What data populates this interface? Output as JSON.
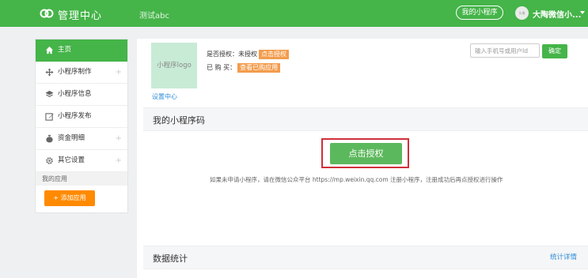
{
  "header": {
    "brand": "管理中心",
    "account": "测试abc",
    "mini_program_button": "我的小程序",
    "avatar_text": "头像",
    "username": "大陶微信小..."
  },
  "sidebar": {
    "items": [
      {
        "label": "主页",
        "icon": "home-icon",
        "active": true
      },
      {
        "label": "小程序制作",
        "icon": "move-icon",
        "expandable": true
      },
      {
        "label": "小程序信息",
        "icon": "layers-icon"
      },
      {
        "label": "小程序发布",
        "icon": "edit-icon"
      },
      {
        "label": "资金明细",
        "icon": "money-bag-icon",
        "expandable": true
      },
      {
        "label": "其它设置",
        "icon": "gear-icon",
        "expandable": true
      }
    ],
    "section_label": "我的应用",
    "add_app_button": "+ 添加应用",
    "expand_glyph": "+"
  },
  "main": {
    "logo_placeholder": "小程序logo",
    "settings_link": "设置中心",
    "authorized_label": "是否授权：未授权",
    "authorize_tag": "点击授权",
    "purchased_label": "已 购 买：",
    "view_purchased_tag": "查看已购应用",
    "search_placeholder": "输入手机号或用户Id",
    "search_value": "",
    "confirm_button": "确定",
    "qrcode_title": "我的小程序码",
    "authorize_button": "点击授权",
    "hint": "如果未申请小程序，请在微信公众平台 https://mp.weixin.qq.com 注册小程序，注册成功后再点授权进行操作",
    "stats_title": "数据统计",
    "stats_detail_link": "统计详情"
  },
  "colors": {
    "brand_green": "#45b449",
    "tag_orange": "#f39c4c",
    "add_button_orange": "#ff8a00",
    "highlight_red": "#d0303a",
    "link_blue": "#2d8cd9"
  }
}
